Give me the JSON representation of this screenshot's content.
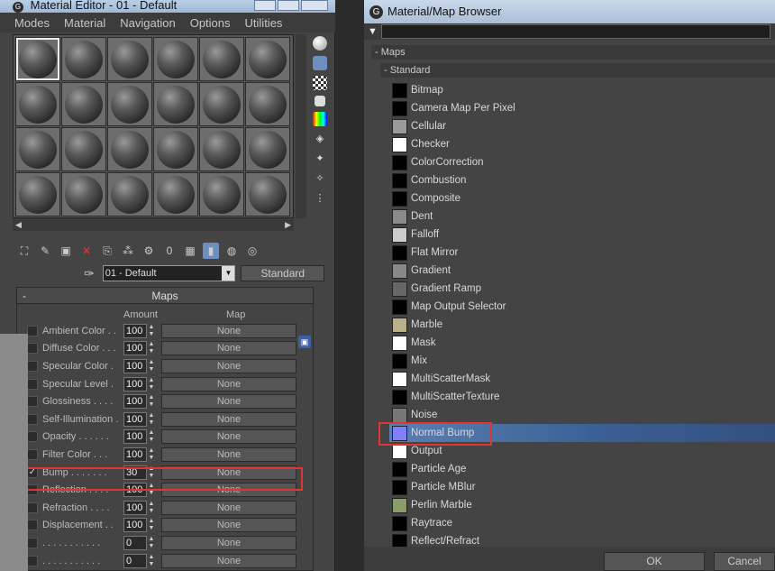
{
  "left": {
    "title": "Material Editor - 01 - Default",
    "menu": [
      "Modes",
      "Material",
      "Navigation",
      "Options",
      "Utilities"
    ],
    "material_name": "01 - Default",
    "material_type": "Standard",
    "rollout_title": "Maps",
    "rollout_toggle": "-",
    "col_amount": "Amount",
    "col_map": "Map",
    "maps": [
      {
        "label": "Ambient Color . .",
        "amount": "100",
        "map": "None",
        "checked": false
      },
      {
        "label": "Diffuse Color . . .",
        "amount": "100",
        "map": "None",
        "checked": false
      },
      {
        "label": "Specular Color  .",
        "amount": "100",
        "map": "None",
        "checked": false
      },
      {
        "label": "Specular Level  .",
        "amount": "100",
        "map": "None",
        "checked": false
      },
      {
        "label": "Glossiness  . . . .",
        "amount": "100",
        "map": "None",
        "checked": false
      },
      {
        "label": "Self-Illumination .",
        "amount": "100",
        "map": "None",
        "checked": false
      },
      {
        "label": "Opacity . . . . . .",
        "amount": "100",
        "map": "None",
        "checked": false
      },
      {
        "label": "Filter Color  . . .",
        "amount": "100",
        "map": "None",
        "checked": false
      },
      {
        "label": "Bump  . . . . . . .",
        "amount": "30",
        "map": "None",
        "checked": true
      },
      {
        "label": "Reflection  . . . .",
        "amount": "100",
        "map": "None",
        "checked": false
      },
      {
        "label": "Refraction  . . . .",
        "amount": "100",
        "map": "None",
        "checked": false
      },
      {
        "label": "Displacement  . .",
        "amount": "100",
        "map": "None",
        "checked": false
      },
      {
        "label": ". . . . . . . . . . .",
        "amount": "0",
        "map": "None",
        "checked": false
      },
      {
        "label": ". . . . . . . . . . .",
        "amount": "0",
        "map": "None",
        "checked": false
      }
    ]
  },
  "right": {
    "title": "Material/Map Browser",
    "search_value": "",
    "group": "- Maps",
    "subgroup": "- Standard",
    "ok": "OK",
    "cancel": "Cancel",
    "items": [
      {
        "label": "Bitmap",
        "swatch": "#000000"
      },
      {
        "label": "Camera Map Per Pixel",
        "swatch": "#000000"
      },
      {
        "label": "Cellular",
        "swatch": "#9a9a9a"
      },
      {
        "label": "Checker",
        "swatch": "#ffffff"
      },
      {
        "label": "ColorCorrection",
        "swatch": "#000000"
      },
      {
        "label": "Combustion",
        "swatch": "#000000"
      },
      {
        "label": "Composite",
        "swatch": "#000000"
      },
      {
        "label": "Dent",
        "swatch": "#8a8a8a"
      },
      {
        "label": "Falloff",
        "swatch": "#cccccc"
      },
      {
        "label": "Flat Mirror",
        "swatch": "#000000"
      },
      {
        "label": "Gradient",
        "swatch": "#888888"
      },
      {
        "label": "Gradient Ramp",
        "swatch": "#666666"
      },
      {
        "label": "Map Output Selector",
        "swatch": "#000000"
      },
      {
        "label": "Marble",
        "swatch": "#b9b08a"
      },
      {
        "label": "Mask",
        "swatch": "#ffffff"
      },
      {
        "label": "Mix",
        "swatch": "#000000"
      },
      {
        "label": "MultiScatterMask",
        "swatch": "#ffffff"
      },
      {
        "label": "MultiScatterTexture",
        "swatch": "#000000"
      },
      {
        "label": "Noise",
        "swatch": "#777777"
      },
      {
        "label": "Normal Bump",
        "swatch": "#8080ff",
        "selected": true
      },
      {
        "label": "Output",
        "swatch": "#ffffff"
      },
      {
        "label": "Particle Age",
        "swatch": "#000000"
      },
      {
        "label": "Particle MBlur",
        "swatch": "#000000"
      },
      {
        "label": "Perlin Marble",
        "swatch": "#8d9a6a"
      },
      {
        "label": "Raytrace",
        "swatch": "#000000"
      },
      {
        "label": "Reflect/Refract",
        "swatch": "#000000"
      }
    ]
  }
}
